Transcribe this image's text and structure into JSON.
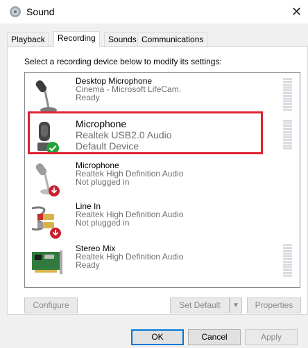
{
  "window": {
    "title": "Sound",
    "close_glyph": "✕"
  },
  "tabs": [
    {
      "label": "Playback",
      "active": false
    },
    {
      "label": "Recording",
      "active": true
    },
    {
      "label": "Sounds",
      "active": false
    },
    {
      "label": "Communications",
      "active": false
    }
  ],
  "instructions": "Select a recording device below to modify its settings:",
  "devices": [
    {
      "name": "Desktop Microphone",
      "line1": "Cinema - Microsoft LifeCam.",
      "line2": "Ready",
      "icon": "desktop-microphone-icon",
      "selected": false
    },
    {
      "name": "Microphone",
      "line1": "Realtek USB2.0 Audio",
      "line2": "Default Device",
      "icon": "usb-microphone-default-icon",
      "selected": true
    },
    {
      "name": "Microphone",
      "line1": "Realtek High Definition Audio",
      "line2": "Not plugged in",
      "icon": "microphone-unplugged-icon",
      "selected": false
    },
    {
      "name": "Line In",
      "line1": "Realtek High Definition Audio",
      "line2": "Not plugged in",
      "icon": "line-in-unplugged-icon",
      "selected": false
    },
    {
      "name": "Stereo Mix",
      "line1": "Realtek High Definition Audio",
      "line2": "Ready",
      "icon": "sound-card-icon",
      "selected": false
    }
  ],
  "panel_buttons": {
    "configure": "Configure",
    "set_default": "Set Default",
    "properties": "Properties"
  },
  "dialog_buttons": {
    "ok": "OK",
    "cancel": "Cancel",
    "apply": "Apply"
  },
  "colors": {
    "highlight": "#e02030",
    "default_check": "#22a33a",
    "unplugged": "#c8202c"
  }
}
